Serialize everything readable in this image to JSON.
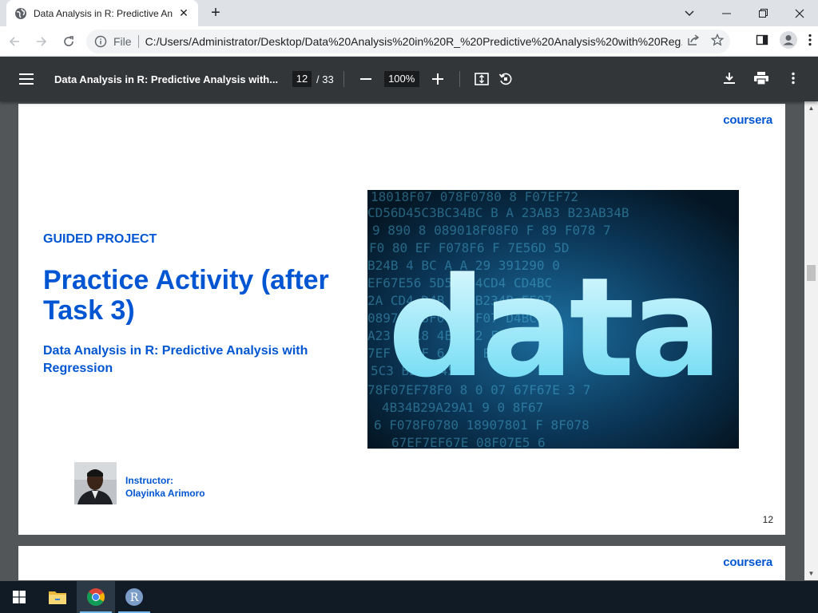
{
  "browser": {
    "tab": {
      "title": "Data Analysis in R: Predictive Ana",
      "close_label": "✕"
    },
    "new_tab_label": "+",
    "omnibox": {
      "scheme_label": "File",
      "url": "C:/Users/Administrator/Desktop/Data%20Analysis%20in%20R_%20Predictive%20Analysis%20with%20Reg..."
    }
  },
  "pdf_toolbar": {
    "title": "Data Analysis in R: Predictive Analysis with...",
    "current_page": "12",
    "page_total": "/ 33",
    "zoom": "100%"
  },
  "slide": {
    "logo": "coursera",
    "kicker": "GUIDED PROJECT",
    "title": "Practice Activity (after Task 3)",
    "subtitle": "Data Analysis in R: Predictive Analysis with Regression",
    "hero_word": "data",
    "instructor_label": "Instructor:",
    "instructor_name": "Olayinka Arimoro",
    "page_number": "12",
    "accent_color": "#0056d2"
  },
  "next_slide": {
    "logo": "coursera"
  },
  "taskbar": {
    "items": [
      "windows-start-icon",
      "file-explorer-icon",
      "chrome-icon",
      "r-app-icon"
    ],
    "r_label": "R"
  }
}
